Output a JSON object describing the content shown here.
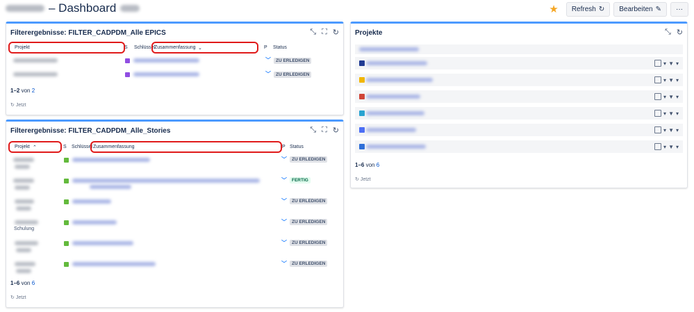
{
  "header": {
    "title": "– Dashboard",
    "refresh_label": "Refresh",
    "edit_label": "Bearbeiten",
    "more_label": "···"
  },
  "epics_panel": {
    "title": "Filterergebnisse: FILTER_CADPDM_Alle EPICS",
    "columns": {
      "project": "Projekt",
      "s": "S",
      "key": "Schlüssel",
      "summary": "Zusammenfassung",
      "p": "P",
      "status": "Status"
    },
    "rows": [
      {
        "status": "ZU ERLEDIGEN"
      },
      {
        "status": "ZU ERLEDIGEN"
      }
    ],
    "count_range": "1–2",
    "count_of": "von",
    "count_total": "2",
    "updated": "Jetzt"
  },
  "stories_panel": {
    "title": "Filterergebnisse: FILTER_CADPDM_Alle_Stories",
    "columns": {
      "project": "Projekt",
      "s": "S",
      "key": "Schlüssel",
      "summary": "Zusammenfassung",
      "p": "P",
      "status": "Status"
    },
    "rows": [
      {
        "status": "ZU ERLEDIGEN",
        "extra": ""
      },
      {
        "status": "FERTIG",
        "extra": ""
      },
      {
        "status": "ZU ERLEDIGEN",
        "extra": ""
      },
      {
        "status": "ZU ERLEDIGEN",
        "extra": "Schulung"
      },
      {
        "status": "ZU ERLEDIGEN",
        "extra": ""
      },
      {
        "status": "ZU ERLEDIGEN",
        "extra": ""
      }
    ],
    "count_range": "1–6",
    "count_of": "von",
    "count_total": "6",
    "updated": "Jetzt"
  },
  "projects_panel": {
    "title": "Projekte",
    "count_range": "1–6",
    "count_of": "von",
    "count_total": "6",
    "updated": "Jetzt",
    "icon_colors": [
      "#1f3a93",
      "#f2b600",
      "#d04437",
      "#29a3d1",
      "#4c6ef5",
      "#2f6fd8"
    ]
  },
  "colors": {
    "accent": "#4c9aff",
    "link": "#0052cc",
    "highlight": "#e01a1a"
  }
}
